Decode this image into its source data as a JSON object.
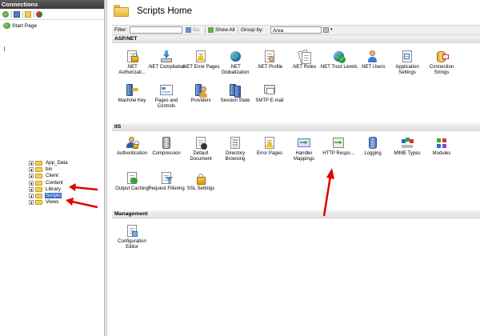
{
  "connections": {
    "title": "Connections",
    "toolbar_icons": [
      "globe-add-icon",
      "save-icon",
      "folder-up-icon",
      "disconnect-icon"
    ],
    "start_page": "Start Page",
    "tree_items": [
      {
        "label": "App_Data",
        "selected": false
      },
      {
        "label": "bin",
        "selected": false
      },
      {
        "label": "Client",
        "selected": false
      },
      {
        "label": "Content",
        "selected": false
      },
      {
        "label": "Library",
        "selected": false
      },
      {
        "label": "Scripts",
        "selected": true
      },
      {
        "label": "Views",
        "selected": false
      }
    ]
  },
  "main": {
    "title": "Scripts Home",
    "filter": {
      "label": "Filter:",
      "value": "",
      "go_label": "Go",
      "show_all_label": "Show All",
      "group_by_label": "Group by:",
      "group_by_value": "Area"
    },
    "sections": [
      {
        "title": "ASP.NET",
        "features": [
          {
            "label": ".NET Authorizati...",
            "icon": "lock-doc-icon"
          },
          {
            "label": ".NET Compilation",
            "icon": "download-icon"
          },
          {
            "label": ".NET Error Pages",
            "icon": "warning-doc-icon"
          },
          {
            "label": ".NET Globalization",
            "icon": "globe-icon"
          },
          {
            "label": ".NET Profile",
            "icon": "profile-doc-icon"
          },
          {
            "label": ".NET Roles",
            "icon": "roles-icon"
          },
          {
            "label": ".NET Trust Levels",
            "icon": "trust-check-icon"
          },
          {
            "label": ".NET Users",
            "icon": "users-icon"
          },
          {
            "label": "Application Settings",
            "icon": "app-settings-icon"
          },
          {
            "label": "Connection Strings",
            "icon": "connection-strings-icon"
          },
          {
            "label": "Machine Key",
            "icon": "machine-key-icon"
          },
          {
            "label": "Pages and Controls",
            "icon": "pages-controls-icon"
          },
          {
            "label": "Providers",
            "icon": "providers-icon"
          },
          {
            "label": "Session State",
            "icon": "session-state-icon"
          },
          {
            "label": "SMTP E-mail",
            "icon": "smtp-email-icon"
          }
        ]
      },
      {
        "title": "IIS",
        "features": [
          {
            "label": "Authentication",
            "icon": "authentication-icon"
          },
          {
            "label": "Compression",
            "icon": "compression-icon"
          },
          {
            "label": "Default Document",
            "icon": "default-document-icon"
          },
          {
            "label": "Directory Browsing",
            "icon": "directory-browsing-icon"
          },
          {
            "label": "Error Pages",
            "icon": "error-pages-icon"
          },
          {
            "label": "Handler Mappings",
            "icon": "handler-mappings-icon"
          },
          {
            "label": "HTTP Respo...",
            "icon": "http-response-icon"
          },
          {
            "label": "Logging",
            "icon": "logging-icon"
          },
          {
            "label": "MIME Types",
            "icon": "mime-types-icon"
          },
          {
            "label": "Modules",
            "icon": "modules-icon"
          },
          {
            "label": "Output Caching",
            "icon": "output-caching-icon"
          },
          {
            "label": "Request Filtering",
            "icon": "request-filtering-icon"
          },
          {
            "label": "SSL Settings",
            "icon": "ssl-lock-icon"
          }
        ]
      },
      {
        "title": "Management",
        "features": [
          {
            "label": "Configuration Editor",
            "icon": "configuration-editor-icon"
          }
        ]
      }
    ]
  },
  "annotations": [
    "red-arrow-content",
    "red-arrow-scripts",
    "red-arrow-http-response"
  ],
  "colors": {
    "selected": "#316ac5",
    "annotation": "#e00000",
    "header": "#3a3a3a"
  }
}
